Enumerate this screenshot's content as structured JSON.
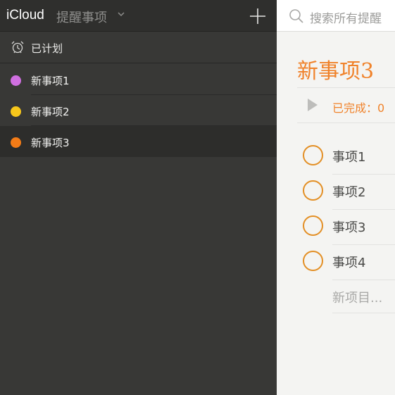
{
  "header": {
    "brand": "iCloud",
    "app_title": "提醒事项"
  },
  "sidebar": {
    "scheduled_label": "已计划",
    "lists": [
      {
        "label": "新事项1",
        "color": "#cf6fe0"
      },
      {
        "label": "新事项2",
        "color": "#f7c71b"
      },
      {
        "label": "新事项3",
        "color": "#f47c17",
        "selected": true
      }
    ]
  },
  "search": {
    "placeholder": "搜索所有提醒"
  },
  "main": {
    "list_title": "新事项3",
    "completed_label": "已完成：0",
    "tasks": [
      {
        "label": "事项1"
      },
      {
        "label": "事项2"
      },
      {
        "label": "事项3"
      },
      {
        "label": "事项4"
      }
    ],
    "new_item_placeholder": "新项目..."
  }
}
